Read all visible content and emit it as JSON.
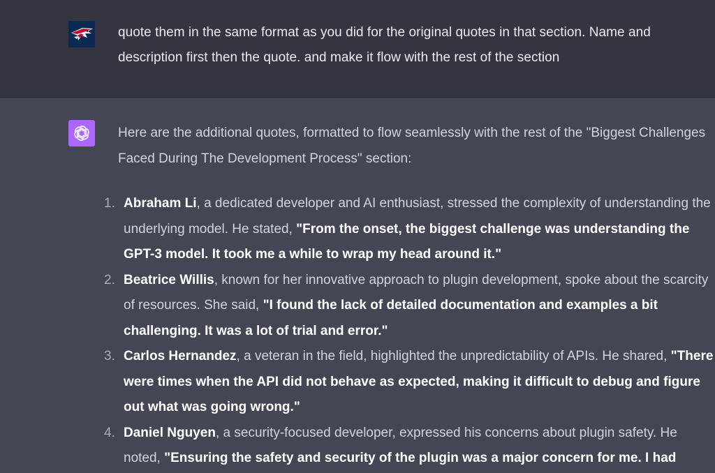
{
  "user_message": {
    "text": "quote them in the same format as you did for the original quotes in that section. Name and description first then the quote. and make it flow with the rest of the section"
  },
  "assistant_message": {
    "intro": "Here are the additional quotes, formatted to flow seamlessly with the rest of the \"Biggest Challenges Faced During The Development Process\" section:",
    "quotes": [
      {
        "number": "1.",
        "name": "Abraham Li",
        "description": ", a dedicated developer and AI enthusiast, stressed the complexity of understanding the underlying model. He stated, ",
        "quote": "\"From the onset, the biggest challenge was understanding the GPT-3 model. It took me a while to wrap my head around it.\""
      },
      {
        "number": "2.",
        "name": "Beatrice Willis",
        "description": ", known for her innovative approach to plugin development, spoke about the scarcity of resources. She said, ",
        "quote": "\"I found the lack of detailed documentation and examples a bit challenging. It was a lot of trial and error.\""
      },
      {
        "number": "3.",
        "name": "Carlos Hernandez",
        "description": ", a veteran in the field, highlighted the unpredictability of APIs. He shared, ",
        "quote": "\"There were times when the API did not behave as expected, making it difficult to debug and figure out what was going wrong.\""
      },
      {
        "number": "4.",
        "name": "Daniel Nguyen",
        "description": ", a security-focused developer, expressed his concerns about plugin safety. He noted, ",
        "quote": "\"Ensuring the safety and security of the plugin was a major concern for me. I had"
      }
    ]
  },
  "icons": {
    "user_avatar": "patriots-logo-icon",
    "assistant_avatar": "openai-logo-icon"
  },
  "colors": {
    "user_bg": "#343541",
    "assistant_bg": "#444654",
    "assistant_avatar_bg": "#ab68ff",
    "text_primary": "#ececf1",
    "text_secondary": "#d1d5db"
  }
}
